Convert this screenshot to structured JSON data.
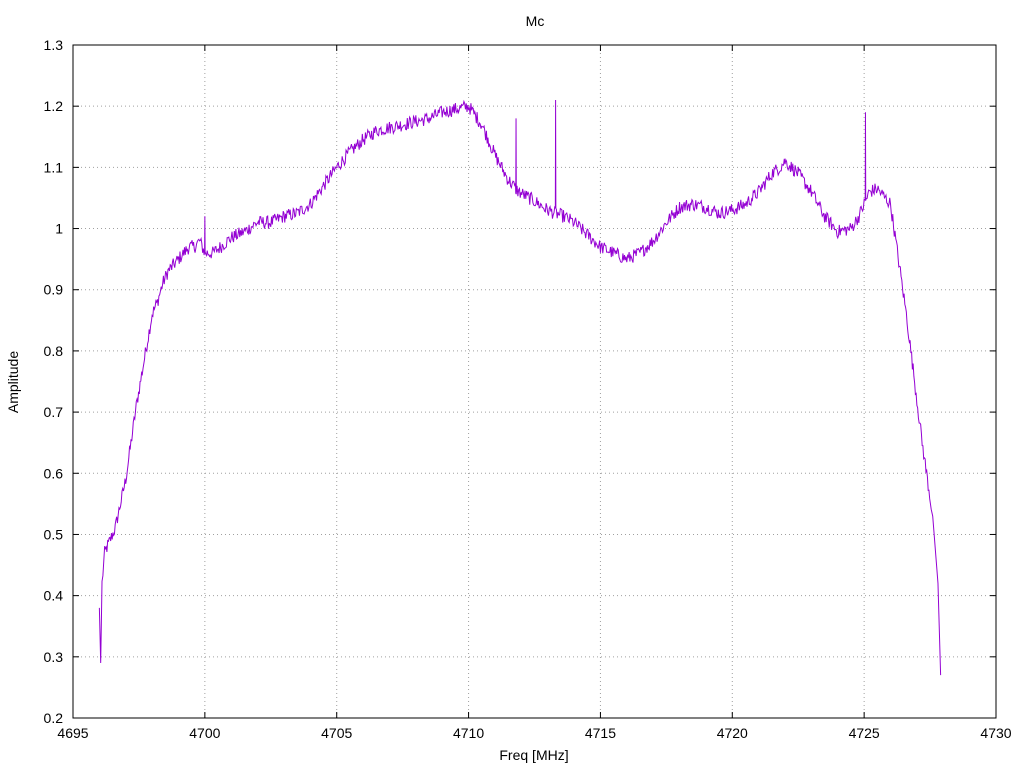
{
  "chart_data": {
    "type": "line",
    "title": "Mc",
    "xlabel": "Freq [MHz]",
    "ylabel": "Amplitude",
    "xlim": [
      4695,
      4730
    ],
    "ylim": [
      0.2,
      1.3
    ],
    "x_ticks": [
      4695,
      4700,
      4705,
      4710,
      4715,
      4720,
      4725,
      4730
    ],
    "y_ticks": [
      0.2,
      0.3,
      0.4,
      0.5,
      0.6,
      0.7,
      0.8,
      0.9,
      1.0,
      1.1,
      1.2,
      1.3
    ],
    "x_tick_labels": [
      "4695",
      "4700",
      "4705",
      "4710",
      "4715",
      "4720",
      "4725",
      "4730"
    ],
    "y_tick_labels": [
      "0.2",
      "0.3",
      "0.4",
      "0.5",
      "0.6",
      "0.7",
      "0.8",
      "0.9",
      "1",
      "1.1",
      "1.2",
      "1.3"
    ],
    "grid": true,
    "line_color": "#9400d3",
    "series": [
      {
        "x": [
          4696.0,
          4696.05,
          4696.1,
          4696.2,
          4696.4,
          4696.6,
          4696.8,
          4697.0,
          4697.2,
          4697.4,
          4697.6,
          4697.8,
          4698.0,
          4698.2,
          4698.4,
          4698.6,
          4698.8,
          4699.0,
          4699.2,
          4699.4,
          4699.6,
          4699.8,
          4700.0,
          4700.3,
          4700.6,
          4701.0,
          4701.5,
          4702.0,
          4702.5,
          4703.0,
          4703.5,
          4704.0,
          4704.5,
          4705.0,
          4705.5,
          4706.0,
          4706.5,
          4707.0,
          4707.5,
          4708.0,
          4708.5,
          4709.0,
          4709.5,
          4710.0,
          4710.5,
          4711.0,
          4711.5,
          4711.9,
          4712.5,
          4713.0,
          4713.3,
          4713.6,
          4714.0,
          4714.5,
          4715.0,
          4715.5,
          4716.0,
          4716.5,
          4717.0,
          4717.5,
          4718.0,
          4718.5,
          4719.0,
          4719.5,
          4720.0,
          4720.5,
          4721.0,
          4721.5,
          4721.8,
          4722.0,
          4722.5,
          4723.0,
          4723.5,
          4724.0,
          4724.5,
          4724.8,
          4725.0,
          4725.2,
          4725.5,
          4725.8,
          4726.0,
          4726.2,
          4726.4,
          4726.6,
          4726.8,
          4727.0,
          4727.2,
          4727.4,
          4727.6,
          4727.8,
          4727.9
        ],
        "y": [
          0.38,
          0.29,
          0.42,
          0.47,
          0.49,
          0.51,
          0.55,
          0.59,
          0.65,
          0.71,
          0.76,
          0.81,
          0.86,
          0.88,
          0.91,
          0.93,
          0.94,
          0.95,
          0.96,
          0.97,
          0.97,
          0.98,
          0.96,
          0.96,
          0.97,
          0.985,
          0.995,
          1.01,
          1.01,
          1.02,
          1.025,
          1.04,
          1.07,
          1.1,
          1.125,
          1.145,
          1.16,
          1.165,
          1.17,
          1.175,
          1.18,
          1.19,
          1.195,
          1.2,
          1.17,
          1.12,
          1.08,
          1.06,
          1.045,
          1.03,
          1.025,
          1.02,
          1.01,
          0.99,
          0.97,
          0.96,
          0.95,
          0.96,
          0.98,
          1.01,
          1.035,
          1.04,
          1.035,
          1.025,
          1.03,
          1.04,
          1.06,
          1.09,
          1.1,
          1.11,
          1.09,
          1.06,
          1.02,
          0.995,
          1.0,
          1.02,
          1.04,
          1.06,
          1.065,
          1.05,
          1.04,
          0.98,
          0.92,
          0.86,
          0.79,
          0.72,
          0.65,
          0.59,
          0.53,
          0.42,
          0.27
        ]
      }
    ],
    "spikes": [
      {
        "x": 4700.0,
        "y": 1.02
      },
      {
        "x": 4711.8,
        "y": 1.18
      },
      {
        "x": 4713.3,
        "y": 1.21
      },
      {
        "x": 4725.05,
        "y": 1.19
      }
    ]
  }
}
